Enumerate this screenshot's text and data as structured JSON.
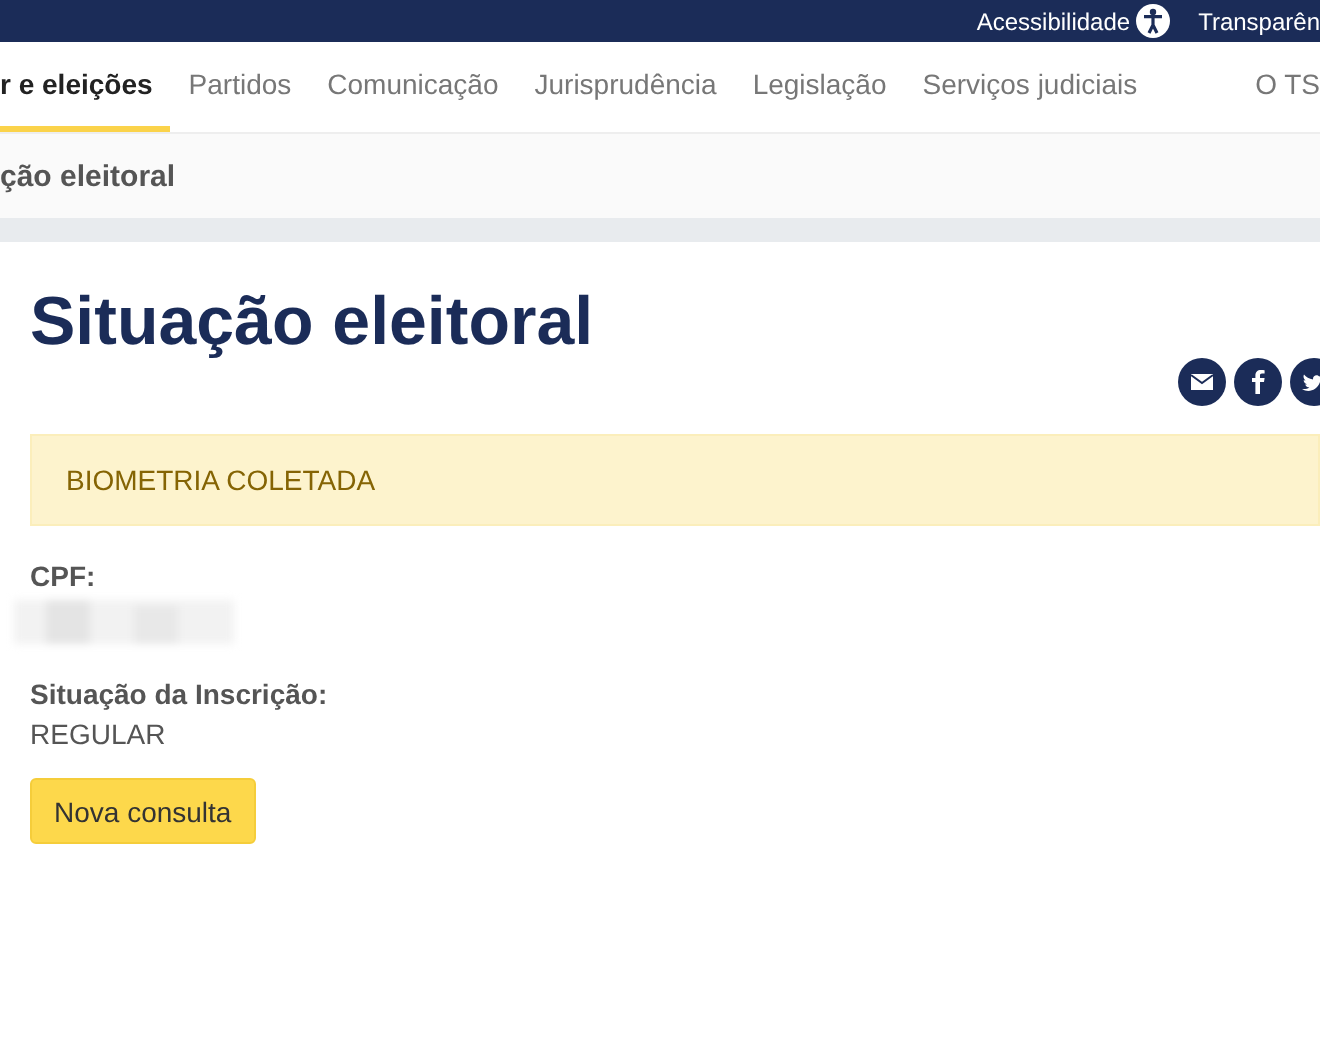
{
  "top_bar": {
    "links": [
      "Acessibilidade",
      "Transparên"
    ]
  },
  "nav": {
    "items": [
      {
        "label": "r e eleições",
        "selected": true
      },
      {
        "label": "Partidos",
        "selected": false
      },
      {
        "label": "Comunicação",
        "selected": false
      },
      {
        "label": "Jurisprudência",
        "selected": false
      },
      {
        "label": "Legislação",
        "selected": false
      },
      {
        "label": "Serviços judiciais",
        "selected": false
      },
      {
        "label": "O TS",
        "selected": false
      }
    ]
  },
  "breadcrumb": "ção eleitoral",
  "title": "Situação eleitoral",
  "share": [
    {
      "kind": "email"
    },
    {
      "kind": "facebook"
    },
    {
      "kind": "twitter"
    }
  ],
  "alert": "BIOMETRIA COLETADA",
  "fields": [
    {
      "label": "CPF:",
      "kind": "blurred"
    },
    {
      "label": "Situação da Inscrição:",
      "kind": "text",
      "value": "REGULAR"
    }
  ],
  "button": "Nova consulta"
}
